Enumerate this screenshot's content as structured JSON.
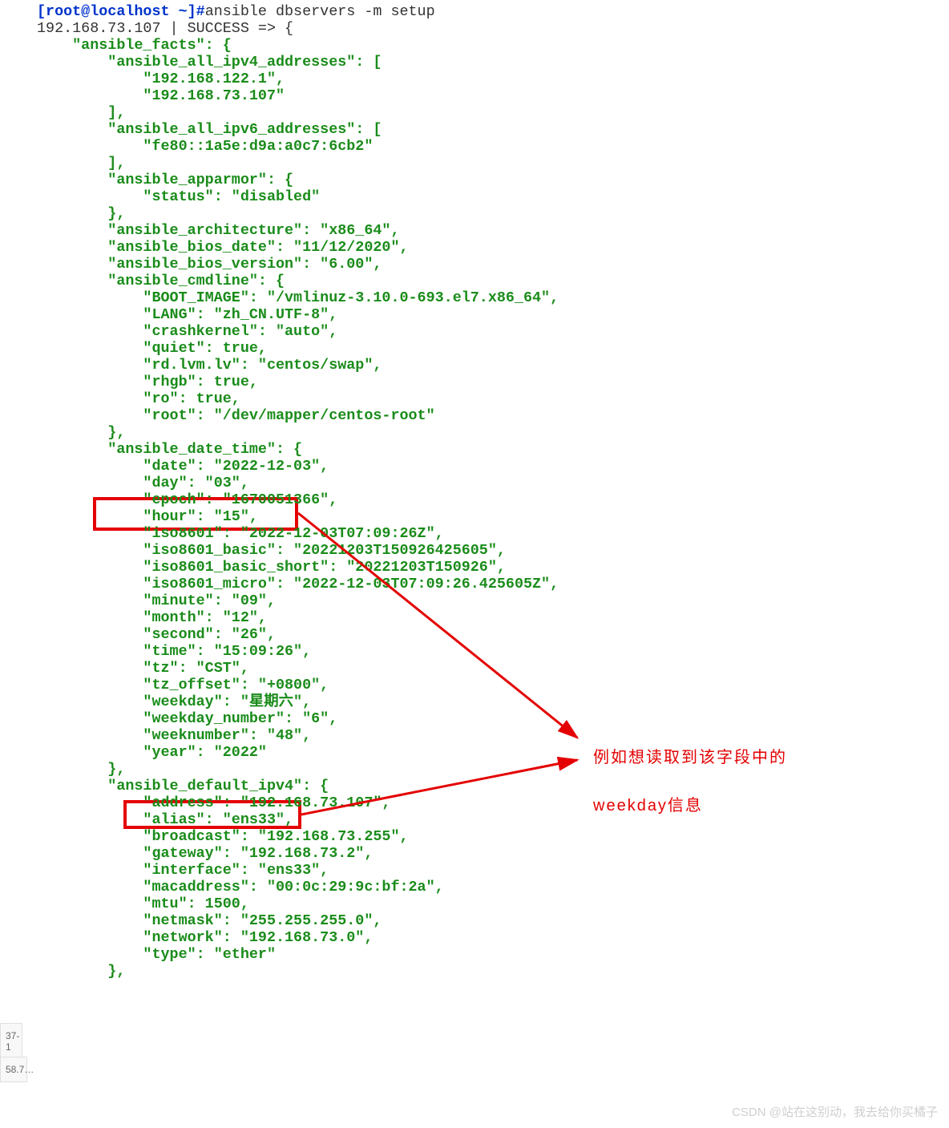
{
  "prompt": {
    "userhost": "[root@localhost ~]#",
    "command": "ansible dbservers -m setup"
  },
  "result_header": "192.168.73.107 | SUCCESS => {",
  "lines": [
    "    \"ansible_facts\": {",
    "        \"ansible_all_ipv4_addresses\": [",
    "            \"192.168.122.1\",",
    "            \"192.168.73.107\"",
    "        ],",
    "        \"ansible_all_ipv6_addresses\": [",
    "            \"fe80::1a5e:d9a:a0c7:6cb2\"",
    "        ],",
    "        \"ansible_apparmor\": {",
    "            \"status\": \"disabled\"",
    "        },",
    "        \"ansible_architecture\": \"x86_64\",",
    "        \"ansible_bios_date\": \"11/12/2020\",",
    "        \"ansible_bios_version\": \"6.00\",",
    "        \"ansible_cmdline\": {",
    "            \"BOOT_IMAGE\": \"/vmlinuz-3.10.0-693.el7.x86_64\",",
    "            \"LANG\": \"zh_CN.UTF-8\",",
    "            \"crashkernel\": \"auto\",",
    "            \"quiet\": true,",
    "            \"rd.lvm.lv\": \"centos/swap\",",
    "            \"rhgb\": true,",
    "            \"ro\": true,",
    "            \"root\": \"/dev/mapper/centos-root\"",
    "        },",
    "        \"ansible_date_time\": {",
    "            \"date\": \"2022-12-03\",",
    "            \"day\": \"03\",",
    "            \"epoch\": \"1670051366\",",
    "            \"hour\": \"15\",",
    "            \"iso8601\": \"2022-12-03T07:09:26Z\",",
    "            \"iso8601_basic\": \"20221203T150926425605\",",
    "            \"iso8601_basic_short\": \"20221203T150926\",",
    "            \"iso8601_micro\": \"2022-12-03T07:09:26.425605Z\",",
    "            \"minute\": \"09\",",
    "            \"month\": \"12\",",
    "            \"second\": \"26\",",
    "            \"time\": \"15:09:26\",",
    "            \"tz\": \"CST\",",
    "            \"tz_offset\": \"+0800\",",
    "            \"weekday\": \"星期六\",",
    "            \"weekday_number\": \"6\",",
    "            \"weeknumber\": \"48\",",
    "            \"year\": \"2022\"",
    "        },",
    "        \"ansible_default_ipv4\": {",
    "            \"address\": \"192.168.73.107\",",
    "            \"alias\": \"ens33\",",
    "            \"broadcast\": \"192.168.73.255\",",
    "            \"gateway\": \"192.168.73.2\",",
    "            \"interface\": \"ens33\",",
    "            \"macaddress\": \"00:0c:29:9c:bf:2a\",",
    "            \"mtu\": 1500,",
    "            \"netmask\": \"255.255.255.0\",",
    "            \"network\": \"192.168.73.0\",",
    "            \"type\": \"ether\"",
    "        },"
  ],
  "annotations": {
    "line1": "例如想读取到该字段中的",
    "line2": "weekday信息"
  },
  "watermark": "CSDN @站在这别动，我去给你买橘子",
  "sidebar": {
    "item1": "37-1",
    "item2": "58.7…"
  }
}
